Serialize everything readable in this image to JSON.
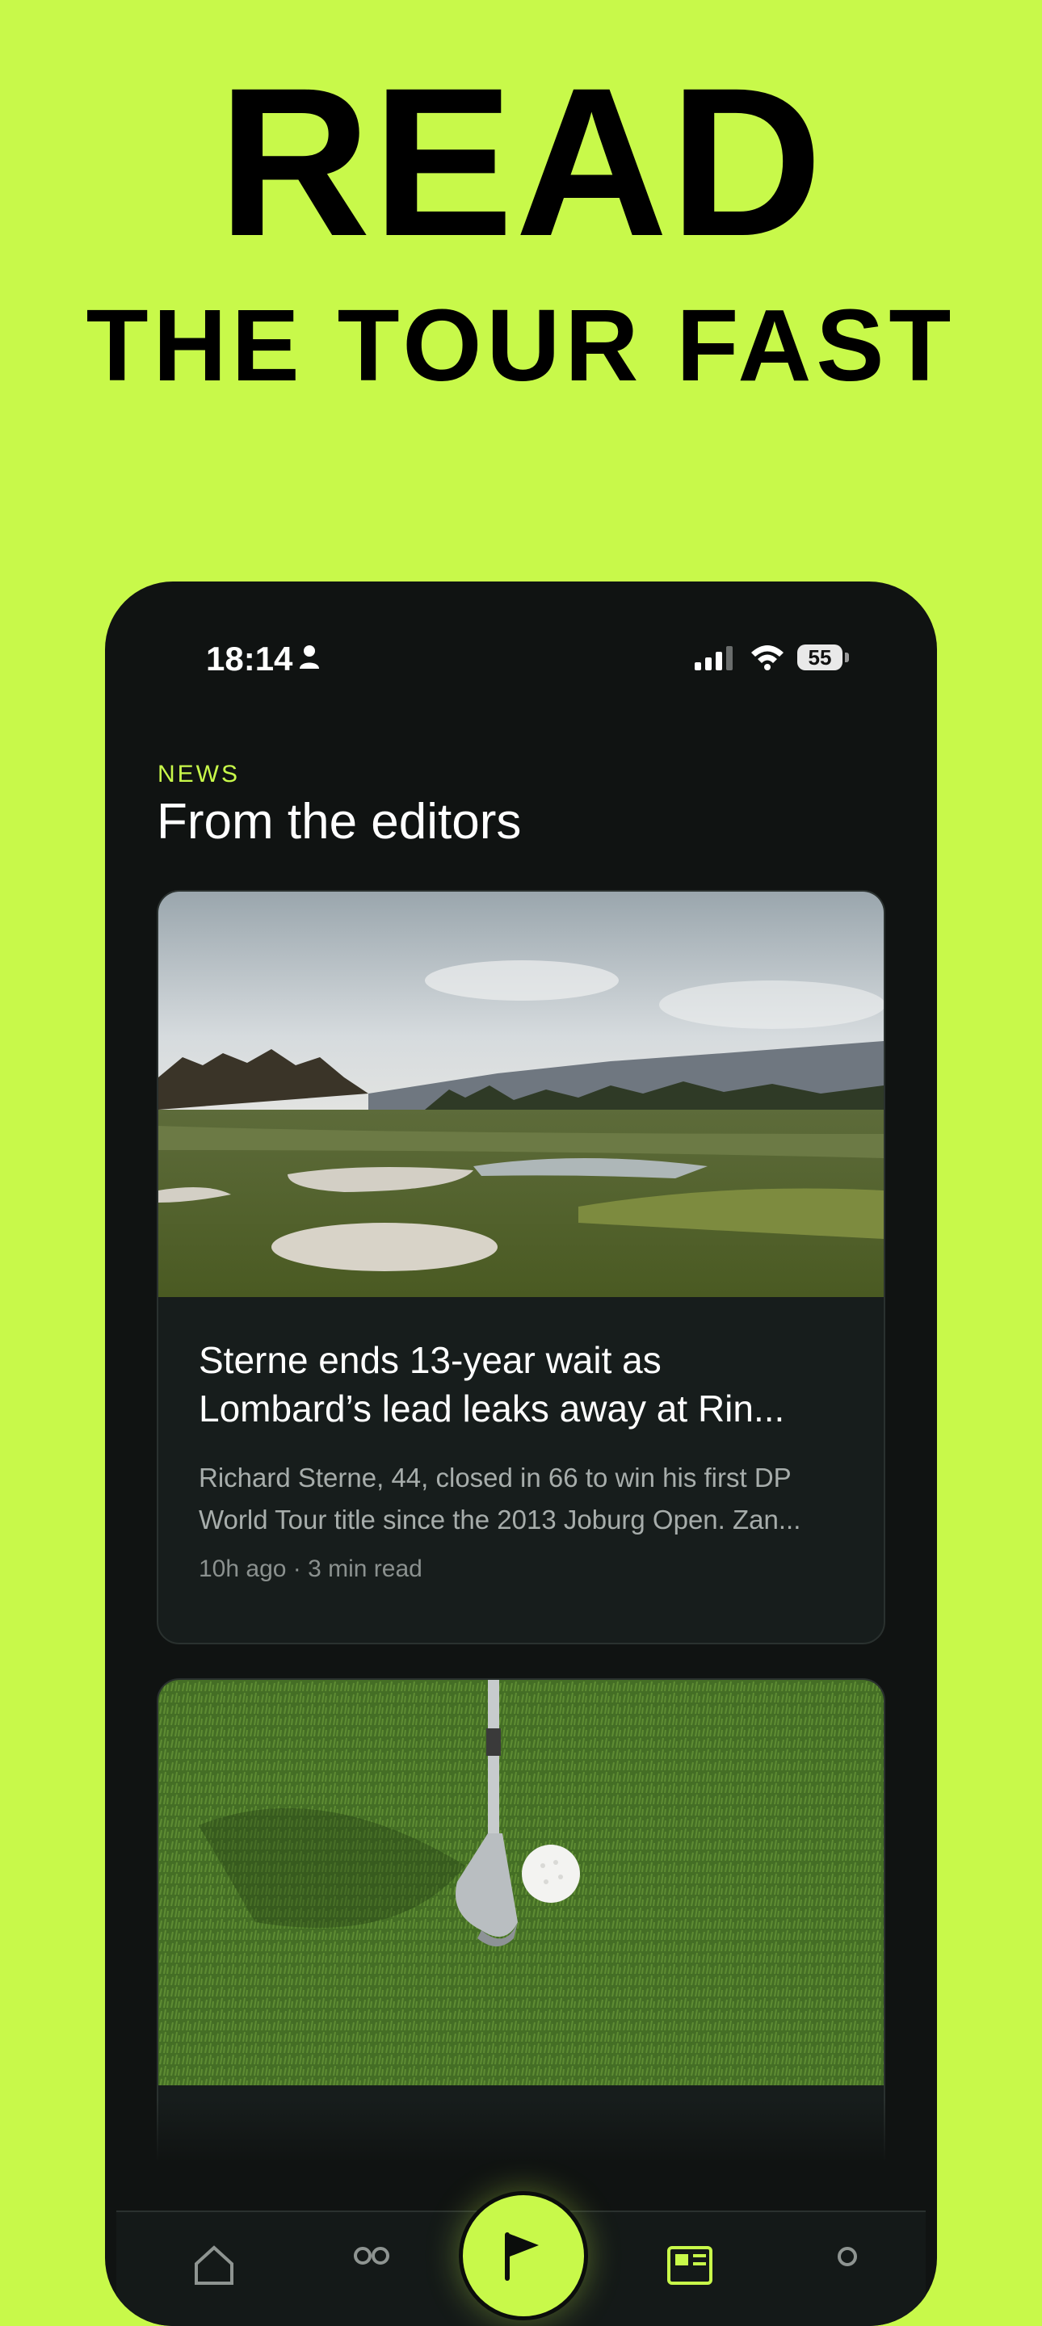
{
  "promo": {
    "headline": "READ",
    "subheadline": "THE TOUR FAST"
  },
  "status_bar": {
    "time": "18:14",
    "battery": "55"
  },
  "section": {
    "label": "NEWS",
    "title": "From the editors"
  },
  "articles": [
    {
      "title_line1": "Sterne ends 13-year wait as",
      "title_line2": "Lombard’s lead leaks away at Rin...",
      "excerpt_line1": "Richard Sterne, 44, closed in 66 to win his first DP",
      "excerpt_line2": "World Tour title since the 2013 Joburg Open. Zan...",
      "meta": "10h ago · 3 min read",
      "image": "golf-course-landscape"
    },
    {
      "image": "golf-wedge-and-ball-on-grass"
    }
  ],
  "tabbar": {
    "items": [
      "home-icon",
      "players-icon",
      "flag-icon",
      "news-icon",
      "profile-icon"
    ],
    "active": "news-icon"
  },
  "colors": {
    "accent": "#c8f94a",
    "background": "#101312",
    "card": "#171d1c"
  }
}
